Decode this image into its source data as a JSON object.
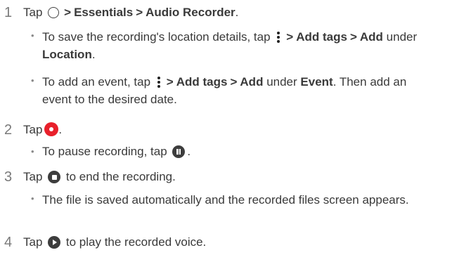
{
  "steps": [
    {
      "number": "1",
      "tap": "Tap",
      "path": [
        "Essentials",
        "Audio Recorder"
      ],
      "end": ".",
      "bullets": [
        {
          "pre": "To save the recording's location details, tap",
          "path": [
            "Add tags",
            "Add"
          ],
          "mid": "under",
          "bold_end": "Location",
          "end": "."
        },
        {
          "pre": "To add an event, tap",
          "path": [
            "Add tags",
            "Add"
          ],
          "mid": "under",
          "bold_end": "Event",
          "end": ". Then add an event to the desired date."
        }
      ]
    },
    {
      "number": "2",
      "tap": "Tap",
      "end": ".",
      "bullets": [
        {
          "pre": "To pause recording, tap",
          "end": "."
        }
      ]
    },
    {
      "number": "3",
      "tap": "Tap",
      "end": "to end the recording.",
      "bullets": [
        {
          "text": "The file is saved automatically and the recorded files screen appears."
        }
      ]
    },
    {
      "number": "4",
      "tap": "Tap",
      "end": "to play the recorded voice."
    }
  ],
  "separator": ">",
  "bullet_glyph": "•",
  "icons": {
    "home": "home-circle-icon",
    "more": "more-options-icon",
    "record": "record-icon",
    "pause": "pause-icon",
    "stop": "stop-icon",
    "play": "play-icon"
  },
  "colors": {
    "record": "#e8202b",
    "text": "#3a3a3a",
    "icon_dark": "#3d3d3d"
  }
}
